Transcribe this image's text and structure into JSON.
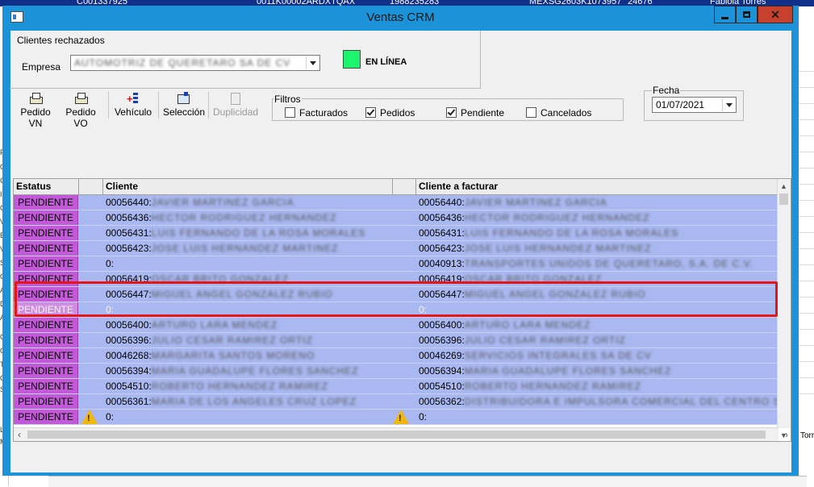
{
  "background": {
    "top_cells": [
      "C001337925",
      "0011K00002ARDXTQAX",
      "1988235283",
      "MEXSG2603K1073957",
      "24676",
      "Fabiola Torres"
    ],
    "left_fragments": [
      "P",
      "O",
      "C",
      "I",
      "CL",
      "V",
      "E",
      "V",
      "S",
      "ON",
      "AP",
      "DE",
      "AS",
      "C",
      "OF",
      "TE",
      "C",
      "SA",
      "L",
      "MI"
    ],
    "right_fragment": "Torr"
  },
  "window": {
    "title": "Ventas CRM",
    "minimize": "—",
    "maximize": "□",
    "close": "✕"
  },
  "header": {
    "group_title": "Clientes rechazados",
    "empresa_label": "Empresa",
    "empresa_value": "AUTOMOTRIZ DE QUERETARO SA DE CV",
    "connection_status": "EN LÍNEA",
    "status_color": "#1ff56c"
  },
  "toolbar": {
    "buttons": [
      {
        "label": "Pedido VN",
        "icon": "printer-icon"
      },
      {
        "label": "Pedido VO",
        "icon": "printer-icon"
      },
      {
        "label": "Vehículo",
        "icon": "vehicle-icon"
      },
      {
        "label": "Selección",
        "icon": "selection-icon"
      },
      {
        "label": "Duplicidad",
        "icon": "duplicate-icon",
        "disabled": true
      }
    ]
  },
  "filters": {
    "title": "Filtros",
    "options": [
      {
        "label": "Facturados",
        "checked": false
      },
      {
        "label": "Pedidos",
        "checked": true
      },
      {
        "label": "Pendiente",
        "checked": true
      },
      {
        "label": "Cancelados",
        "checked": false
      }
    ]
  },
  "fecha": {
    "label": "Fecha",
    "value": "01/07/2021"
  },
  "grid": {
    "columns": [
      "Estatus",
      "",
      "Cliente",
      "",
      "Cliente a facturar"
    ],
    "colors": {
      "row": "#a9b8f1",
      "status": "#c25ad8"
    },
    "rows": [
      {
        "status": "PENDIENTE",
        "cliente_id": "00056440:",
        "cliente_name": "JAVIER MARTINEZ GARCIA",
        "factura_id": "00056440:",
        "factura_name": "JAVIER MARTINEZ GARCIA"
      },
      {
        "status": "PENDIENTE",
        "cliente_id": "00056436:",
        "cliente_name": "HECTOR RODRIGUEZ HERNANDEZ",
        "factura_id": "00056436:",
        "factura_name": "HECTOR RODRIGUEZ HERNANDEZ"
      },
      {
        "status": "PENDIENTE",
        "cliente_id": "00056431:",
        "cliente_name": "LUIS FERNANDO DE LA ROSA MORALES",
        "factura_id": "00056431:",
        "factura_name": "LUIS FERNANDO DE LA ROSA MORALES"
      },
      {
        "status": "PENDIENTE",
        "cliente_id": "00056423:",
        "cliente_name": "JOSE LUIS HERNANDEZ MARTINEZ",
        "factura_id": "00056423:",
        "factura_name": "JOSE LUIS HERNANDEZ MARTINEZ"
      },
      {
        "status": "PENDIENTE",
        "cliente_id": "0:",
        "cliente_name": "",
        "factura_id": "00040913:",
        "factura_name": "TRANSPORTES UNIDOS DE QUERETARO, S.A. DE C.V."
      },
      {
        "status": "PENDIENTE",
        "cliente_id": "00056419:",
        "cliente_name": "OSCAR BRITO GONZALEZ",
        "factura_id": "00056419:",
        "factura_name": "OSCAR BRITO GONZALEZ"
      },
      {
        "status": "PENDIENTE",
        "cliente_id": "00056447:",
        "cliente_name": "MIGUEL ANGEL GONZALEZ RUBIO",
        "factura_id": "00056447:",
        "factura_name": "MIGUEL ANGEL GONZALEZ RUBIO"
      },
      {
        "status": "PENDIENTE",
        "cliente_id": "0:",
        "cliente_name": "",
        "factura_id": "0:",
        "factura_name": ""
      },
      {
        "status": "PENDIENTE",
        "cliente_id": "00056400:",
        "cliente_name": "ARTURO LARA MENDEZ",
        "factura_id": "00056400:",
        "factura_name": "ARTURO LARA MENDEZ"
      },
      {
        "status": "PENDIENTE",
        "cliente_id": "00056396:",
        "cliente_name": "JULIO CESAR RAMIREZ ORTIZ",
        "factura_id": "00056396:",
        "factura_name": "JULIO CESAR RAMIREZ ORTIZ"
      },
      {
        "status": "PENDIENTE",
        "cliente_id": "00046268:",
        "cliente_name": "MARGARITA SANTOS MORENO",
        "factura_id": "00046269:",
        "factura_name": "SERVICIOS INTEGRALES SA DE CV"
      },
      {
        "status": "PENDIENTE",
        "cliente_id": "00056394:",
        "cliente_name": "MARIA GUADALUPE FLORES SANCHEZ",
        "factura_id": "00056394:",
        "factura_name": "MARIA GUADALUPE FLORES SANCHEZ"
      },
      {
        "status": "PENDIENTE",
        "cliente_id": "00054510:",
        "cliente_name": "ROBERTO HERNANDEZ RAMIREZ",
        "factura_id": "00054510:",
        "factura_name": "ROBERTO HERNANDEZ RAMIREZ"
      },
      {
        "status": "PENDIENTE",
        "cliente_id": "00056361:",
        "cliente_name": "MARIA DE LOS ANGELES CRUZ LOPEZ",
        "factura_id": "00056362:",
        "factura_name": "DISTRIBUIDORA E IMPULSORA COMERCIAL DEL CENTRO SA DE CV Y SUS FILIALES BIENES EL"
      },
      {
        "status": "PENDIENTE",
        "cliente_id": "0:",
        "cliente_name": "",
        "factura_id": "0:",
        "factura_name": "",
        "warning": true
      }
    ]
  }
}
